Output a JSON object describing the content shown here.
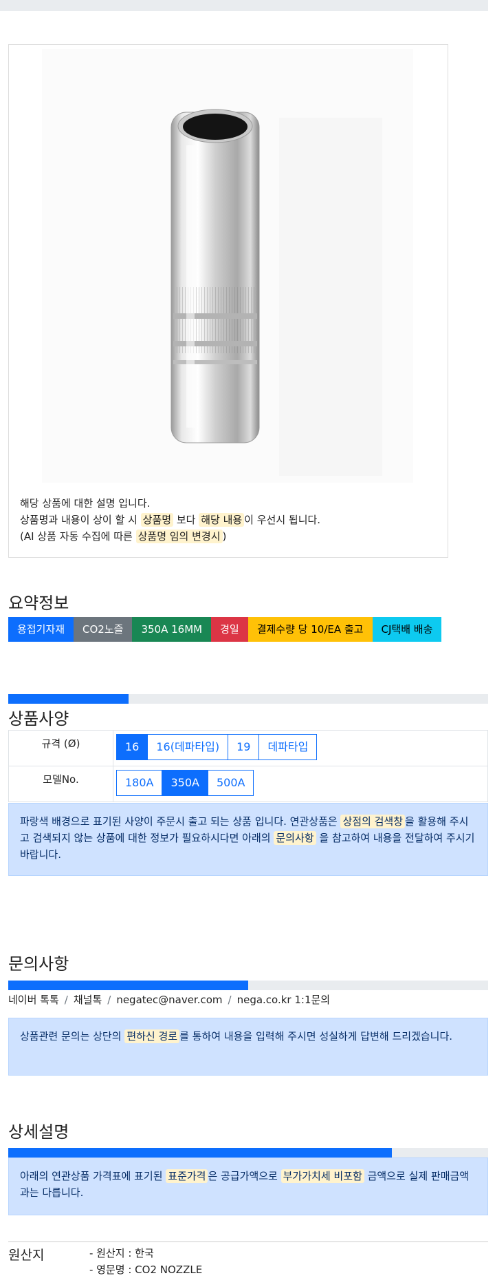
{
  "product": {
    "image_icon": "welding-nozzle-photo",
    "description": {
      "line1": "해당 상품에 대한 설명 입니다.",
      "line2_a": "상품명과 내용이 상이 할 시 ",
      "line2_hl1": "상품명",
      "line2_b": " 보다 ",
      "line2_hl2": "해당 내용",
      "line2_c": "이 우선시 됩니다.",
      "line3_a": "(AI 상품 자동 수집에 따른 ",
      "line3_hl": "상품명 임의 변경시",
      "line3_b": ")"
    }
  },
  "summary": {
    "title": "요약정보",
    "badges": [
      {
        "label": "용접기자재",
        "color": "#0d6efd"
      },
      {
        "label": "CO2노즐",
        "color": "#6c757d"
      },
      {
        "label": "350A 16MM",
        "color": "#198754"
      },
      {
        "label": "경일",
        "color": "#dc3545"
      },
      {
        "label": "결제수량 당 10/EA 출고",
        "color": "#ffc107",
        "text_color": "#000000"
      },
      {
        "label": "CJ택배 배송",
        "color": "#0dcaf0",
        "text_color": "#000000"
      }
    ]
  },
  "specs": {
    "progress": 0.25,
    "title": "상품사양",
    "rows": [
      {
        "label": "규격 (Ø)",
        "options": [
          {
            "label": "16",
            "active": true
          },
          {
            "label": "16(데파타입)",
            "active": false
          },
          {
            "label": "19",
            "active": false
          },
          {
            "label": "데파타입",
            "active": false
          }
        ]
      },
      {
        "label": "모델No.",
        "options": [
          {
            "label": "180A",
            "active": false
          },
          {
            "label": "350A",
            "active": true
          },
          {
            "label": "500A",
            "active": false
          }
        ]
      }
    ],
    "note": {
      "a": "파랑색 배경으로 표기된 사양이 주문시 출고 되는 상품 입니다. 연관상품은 ",
      "hl1": "상점의 검색창",
      "b": "을 활용해 주시고 검색되지 않는 상품에 대한 정보가 필요하시다면 아래의 ",
      "hl2": "문의사항",
      "c": " 을 참고하여 내용을 전달하여 주시기 바랍니다."
    }
  },
  "inquiry": {
    "title": "문의사항",
    "progress": 0.5,
    "contacts": [
      "네이버 톡톡",
      "채널톡",
      "negatec@naver.com",
      "nega.co.kr 1:1문의"
    ],
    "separator": "/",
    "note": {
      "a": "상품관련 문의는 상단의 ",
      "hl": "편하신 경로",
      "b": "를 통하여 내용을 입력해 주시면 성실하게 답변해 드리겠습니다."
    }
  },
  "detail": {
    "title": "상세설명",
    "progress": 0.8,
    "note": {
      "a": "아래의 연관상품 가격표에 표기된 ",
      "hl1": "표준가격",
      "b": "은 공급가액으로 ",
      "hl2": "부가가치세 비포함",
      "c": " 금액으로 실제 판매금액과는 다릅니다."
    }
  },
  "origin": {
    "label": "원산지",
    "items": [
      "- 원산지 : 한국",
      "- 영문명 : CO2 NOZZLE"
    ]
  }
}
